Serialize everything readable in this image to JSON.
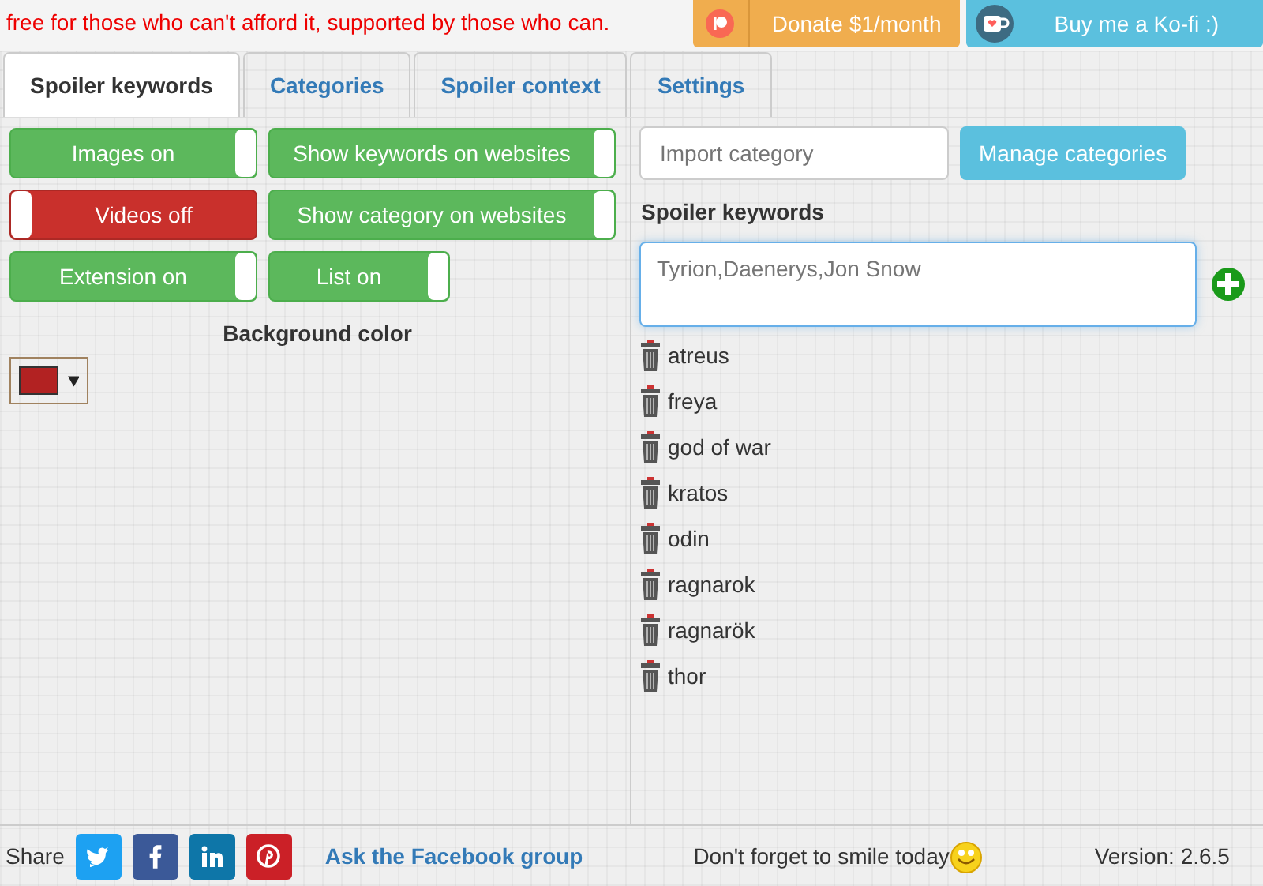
{
  "banner": {
    "text": "free for those who can't afford it, supported by those who can.",
    "donate_button": "Donate $1/month",
    "kofi_button": "Buy me a Ko-fi :)"
  },
  "tabs": [
    {
      "label": "Spoiler keywords",
      "selected": true
    },
    {
      "label": "Categories",
      "selected": false
    },
    {
      "label": "Spoiler context",
      "selected": false
    },
    {
      "label": "Settings",
      "selected": false
    }
  ],
  "toggles": [
    {
      "label": "Images on",
      "on": true
    },
    {
      "label": "Show keywords on websites",
      "on": true
    },
    {
      "label": "Videos off",
      "on": false
    },
    {
      "label": "Show category on websites",
      "on": true
    },
    {
      "label": "Extension on",
      "on": true
    },
    {
      "label": "List on",
      "on": true
    }
  ],
  "background_color": {
    "label": "Background color",
    "color": "#b22222"
  },
  "import_field": {
    "placeholder": "Import category"
  },
  "manage_button": "Manage categories",
  "keywords_heading": "Spoiler keywords",
  "keywords_field": {
    "placeholder": "Tyrion,Daenerys,Jon Snow"
  },
  "keywords": [
    "atreus",
    "freya",
    "god of war",
    "kratos",
    "odin",
    "ragnarok",
    "ragnarök",
    "thor"
  ],
  "footer": {
    "share_label": "Share",
    "share_buttons": [
      {
        "kind": "twitter",
        "color": "#1da1f2"
      },
      {
        "kind": "facebook",
        "color": "#3b5998"
      },
      {
        "kind": "linkedin",
        "color": "#0e76a8"
      },
      {
        "kind": "pinterest",
        "color": "#cb2027"
      }
    ],
    "facebook_link": "Ask the Facebook group",
    "smile_text": "Don't forget to smile today",
    "version": "Version: 2.6.5"
  }
}
